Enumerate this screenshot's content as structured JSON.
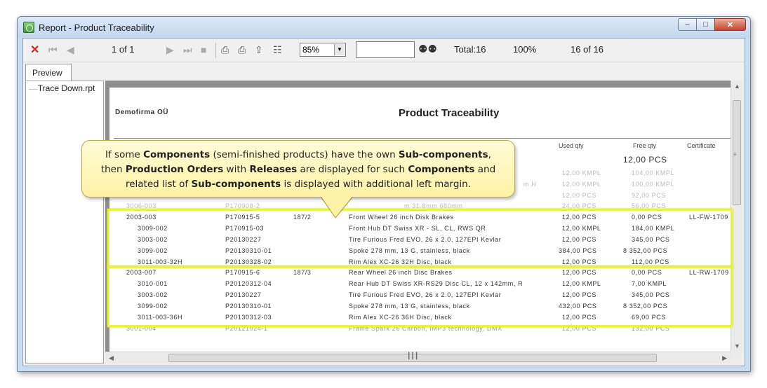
{
  "window": {
    "title": "Report - Product Traceability"
  },
  "toolbar": {
    "page_indicator": "1 of 1",
    "zoom": "85%",
    "search_value": "",
    "total": "Total:16",
    "percent": "100%",
    "records": "16 of 16"
  },
  "tabs": [
    {
      "label": "Preview"
    }
  ],
  "tree": {
    "items": [
      {
        "label": "Trace Down.rpt"
      }
    ]
  },
  "report": {
    "company": "Demofirma OÜ",
    "title": "Product Traceability",
    "columns": {
      "used_qty": "Used qty",
      "free_qty": "Free qty",
      "certificate": "Certificate"
    },
    "first_free": "12,00 PCS",
    "faded_rows": [
      {
        "used": "12,00 KMPL",
        "free": "104,00 KMPL"
      },
      {
        "used": "12,00 KMPL",
        "free": "100,00 KMPL",
        "desc_tail": "m H"
      },
      {
        "used": "12,00 PCS",
        "free": "92,00 PCS"
      },
      {
        "code": "3006-003",
        "order": "P170908-2",
        "desc_tail": "m 31.8mm 680mm",
        "used": "24,00 PCS",
        "free": "56,00 PCS"
      }
    ],
    "groups": [
      {
        "rows": [
          {
            "code": "2003-003",
            "order": "P170915-5",
            "release": "187/2",
            "desc": "Front Wheel 26 inch Disk Brakes",
            "used": "12,00 PCS",
            "free": "0,00 PCS",
            "cert": "LL-FW-1709"
          },
          {
            "code": "3009-002",
            "order": "P170915-03",
            "release": "",
            "desc": "Front Hub DT Swiss XR - SL, CL, RWS QR",
            "used": "12,00 KMPL",
            "free": "184,00 KMPL",
            "cert": ""
          },
          {
            "code": "3003-002",
            "order": "P20130227",
            "release": "",
            "desc": "Tire Furious Fred EVO, 26 x 2.0, 127EPI Kevlar",
            "used": "12,00 PCS",
            "free": "345,00 PCS",
            "cert": ""
          },
          {
            "code": "3099-002",
            "order": "P20130310-01",
            "release": "",
            "desc": "Spoke 278 mm, 13 G, stainless, black",
            "used": "384,00 PCS",
            "free": "8 352,00 PCS",
            "cert": ""
          },
          {
            "code": "3011-003-32H",
            "order": "P20130328-02",
            "release": "",
            "desc": "Rim Alex XC-26 32H Disc, black",
            "used": "12,00 PCS",
            "free": "112,00 PCS",
            "cert": ""
          }
        ]
      },
      {
        "rows": [
          {
            "code": "2003-007",
            "order": "P170915-6",
            "release": "187/3",
            "desc": "Rear Wheel 26 inch Disc Brakes",
            "used": "12,00 PCS",
            "free": "0,00 PCS",
            "cert": "LL-RW-1709"
          },
          {
            "code": "3010-001",
            "order": "P20120312-04",
            "release": "",
            "desc": "Rear Hub DT Swiss XR-RS29 Disc CL, 12 x 142mm, R",
            "used": "12,00 KMPL",
            "free": "7,00 KMPL",
            "cert": ""
          },
          {
            "code": "3003-002",
            "order": "P20130227",
            "release": "",
            "desc": "Tire Furious Fred EVO, 26 x 2.0, 127EPI Kevlar",
            "used": "12,00 PCS",
            "free": "345,00 PCS",
            "cert": ""
          },
          {
            "code": "3099-002",
            "order": "P20130310-01",
            "release": "",
            "desc": "Spoke 278 mm, 13 G, stainless, black",
            "used": "432,00 PCS",
            "free": "8 352,00 PCS",
            "cert": ""
          },
          {
            "code": "3011-003-36H",
            "order": "P20130312-03",
            "release": "",
            "desc": "Rim Alex XC-26 36H Disc, black",
            "used": "12,00 PCS",
            "free": "69,00 PCS",
            "cert": ""
          }
        ]
      }
    ],
    "last_row": {
      "code": "3001-004",
      "order": "P20121024-1",
      "desc": "Frame Spark 26 Carbon, IMP3 technology, DMX",
      "used": "12,00 PCS",
      "free": "132,00 PCS"
    }
  },
  "callout": {
    "line1_a": "If some ",
    "line1_b": "Components",
    "line1_c": " (semi-finished products) have the own ",
    "line1_d": "Sub-components",
    "line1_e": ",",
    "line2_a": "then ",
    "line2_b": "Production Orders",
    "line2_c": " with ",
    "line2_d": "Releases",
    "line2_e": " are displayed for such ",
    "line2_f": "Components",
    "line2_g": " and",
    "line3_a": "related list of ",
    "line3_b": "Sub-components",
    "line3_c": " is displayed with additional left margin."
  }
}
